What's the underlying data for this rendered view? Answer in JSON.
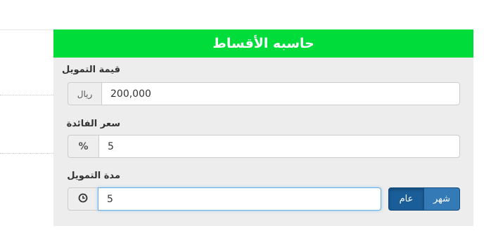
{
  "calculator": {
    "title": "حاسبه الأقساط",
    "header_color": "#00dd3a",
    "financing_amount": {
      "label": "قيمة التمويل",
      "unit": "ريال",
      "value": "200,000"
    },
    "interest_rate": {
      "label": "سعر الفائدة",
      "unit": "%",
      "value": "5"
    },
    "financing_period": {
      "label": "مدة التمويل",
      "icon": "clock-icon",
      "value": "5",
      "toggle": {
        "year_label": "عام",
        "month_label": "شهر",
        "selected": "عام"
      }
    }
  }
}
